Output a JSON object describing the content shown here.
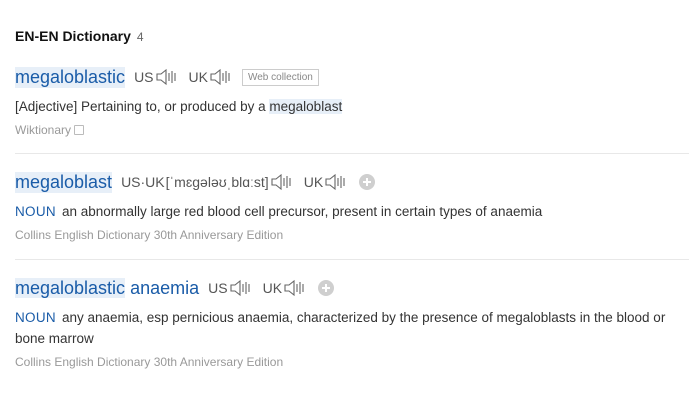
{
  "section": {
    "title": "EN-EN Dictionary",
    "count": "4"
  },
  "entries": [
    {
      "word": "megaloblastic",
      "us_label": "US",
      "uk_label": "UK",
      "tag": "Web collection",
      "definition_prefix": "[Adjective] Pertaining to, or produced by a ",
      "definition_link": "megaloblast",
      "source": "Wiktionary"
    },
    {
      "word": "megaloblast",
      "us_uk_label": "US·UK",
      "ipa": "[ˈmɛɡələʊˌblɑːst]",
      "uk_label": "UK",
      "pos": "NOUN",
      "definition": "an abnormally large red blood cell precursor, present in certain types of anaemia",
      "source": "Collins English Dictionary 30th Anniversary Edition"
    },
    {
      "word_highlight": "megaloblastic",
      "word_rest": " anaemia",
      "us_label": "US",
      "uk_label": "UK",
      "pos": "NOUN",
      "definition": "any anaemia, esp pernicious anaemia, characterized by the presence of megaloblasts in the blood or bone marrow",
      "source": "Collins English Dictionary 30th Anniversary Edition"
    }
  ]
}
